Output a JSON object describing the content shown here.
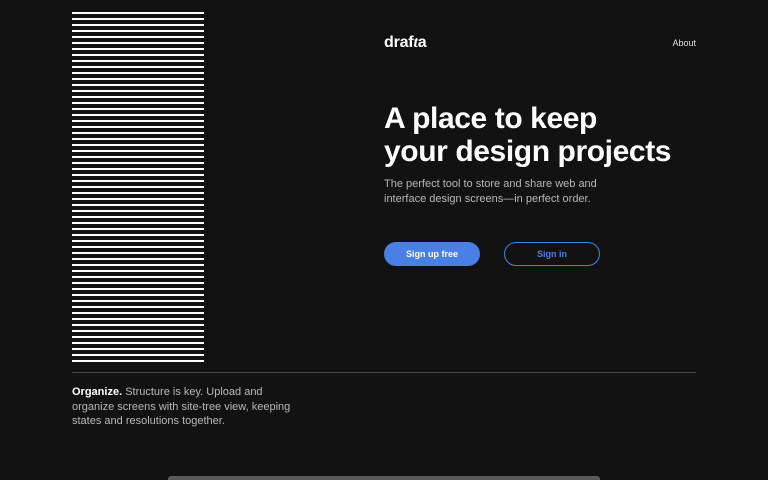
{
  "header": {
    "logo_prefix": "draf",
    "logo_italic": "t",
    "logo_suffix": "a",
    "nav_about": "About"
  },
  "hero": {
    "headline_line1": "A place to keep",
    "headline_line2": "your design projects",
    "subhead": "The perfect tool to store and share web and interface design screens—in perfect order.",
    "signup_label": "Sign up free",
    "signin_label": "Sign in"
  },
  "features": [
    {
      "title": "Organize.",
      "text": "Structure is key. Upload and organize screens with site-tree view, keeping states and resolutions together."
    }
  ],
  "colors": {
    "background": "#121212",
    "accent": "#4a7fe5",
    "text_muted": "#b8b8b8"
  }
}
